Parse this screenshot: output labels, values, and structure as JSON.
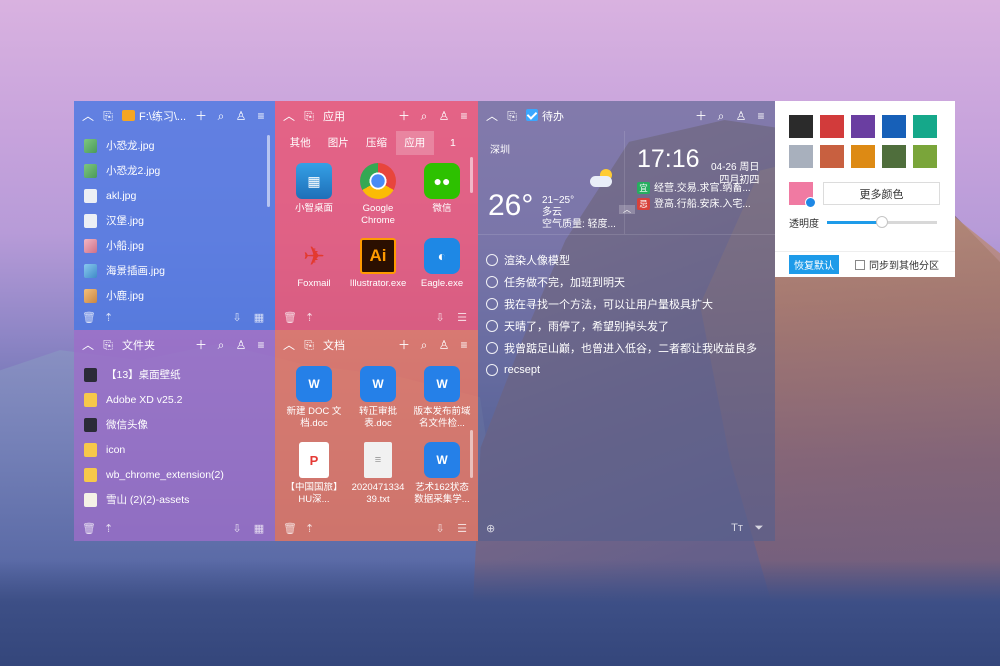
{
  "panels": {
    "folder": {
      "title": "F:\\练习\\...",
      "files": [
        {
          "name": "小恐龙.jpg",
          "thumb": "green"
        },
        {
          "name": "小恐龙2.jpg",
          "thumb": "green"
        },
        {
          "name": "akl.jpg",
          "thumb": "white"
        },
        {
          "name": "汉堡.jpg",
          "thumb": "white"
        },
        {
          "name": "小船.jpg",
          "thumb": "pink"
        },
        {
          "name": "海景插画.jpg",
          "thumb": "sea"
        },
        {
          "name": "小鹿.jpg",
          "thumb": "deer"
        }
      ]
    },
    "apps": {
      "title": "应用",
      "tabs": [
        "其他",
        "图片",
        "压缩",
        "应用",
        "1"
      ],
      "active_tab": "应用",
      "items": [
        {
          "name": "小智桌面",
          "icon": "desktop-app-icon"
        },
        {
          "name": "Google Chrome",
          "icon": "chrome-icon"
        },
        {
          "name": "微信",
          "icon": "wechat-icon"
        },
        {
          "name": "Foxmail",
          "icon": "foxmail-icon"
        },
        {
          "name": "Illustrator.exe",
          "icon": "illustrator-icon"
        },
        {
          "name": "Eagle.exe",
          "icon": "eagle-icon"
        }
      ]
    },
    "folders": {
      "title": "文件夹",
      "items": [
        {
          "name": "【13】桌面壁纸",
          "thumb": "dark"
        },
        {
          "name": "Adobe XD v25.2",
          "thumb": "folder"
        },
        {
          "name": "微信头像",
          "thumb": "dark"
        },
        {
          "name": "icon",
          "thumb": "folder"
        },
        {
          "name": "wb_chrome_extension(2)",
          "thumb": "folder"
        },
        {
          "name": "雪山 (2)(2)-assets",
          "thumb": "doc"
        }
      ]
    },
    "docs": {
      "title": "文档",
      "items": [
        {
          "name": "新建 DOC 文档.doc",
          "icon": "wps-doc-icon"
        },
        {
          "name": "转正审批表.doc",
          "icon": "wps-doc-icon"
        },
        {
          "name": "版本发布前域名文件检...",
          "icon": "wps-doc-icon"
        },
        {
          "name": "【中国国旅】HU深...",
          "icon": "pdf-icon"
        },
        {
          "name": "2020471334 39.txt",
          "icon": "txt-icon"
        },
        {
          "name": "艺术162状态数据采集学...",
          "icon": "wps-doc-icon"
        }
      ]
    },
    "todo": {
      "title": "待办",
      "weather": {
        "city": "深圳",
        "temp": "26°",
        "range": "21~25°",
        "condition": "多云",
        "air": "空气质量: 轻度..."
      },
      "clock": {
        "time": "17:16",
        "date": "04-26 周日",
        "lunar": "四月初四",
        "yi_tag": "宜",
        "yi_text": "经营.交易.求官.纳畜...",
        "ji_tag": "忌",
        "ji_text": "登高.行船.安床.入宅..."
      },
      "items": [
        "渲染人像模型",
        "任务做不完，加班到明天",
        "我在寻找一个方法，可以让用户量极具扩大",
        "天晴了，雨停了，希望别掉头发了",
        "我曾踮足山巅，也曾进入低谷，二者都让我收益良多",
        "recsept"
      ]
    }
  },
  "picker": {
    "swatches": [
      "#2b2b2b",
      "#d23b3b",
      "#6a3ea1",
      "#1760b8",
      "#15a88a",
      "#a8b0bd",
      "#c86040",
      "#dd8a14",
      "#4f6e3c",
      "#7aa53a"
    ],
    "custom_color": "#f07aa2",
    "more_colors_label": "更多颜色",
    "opacity_label": "透明度",
    "opacity_value": 0.5,
    "reset_label": "恢复默认",
    "sync_label": "同步到其他分区"
  }
}
